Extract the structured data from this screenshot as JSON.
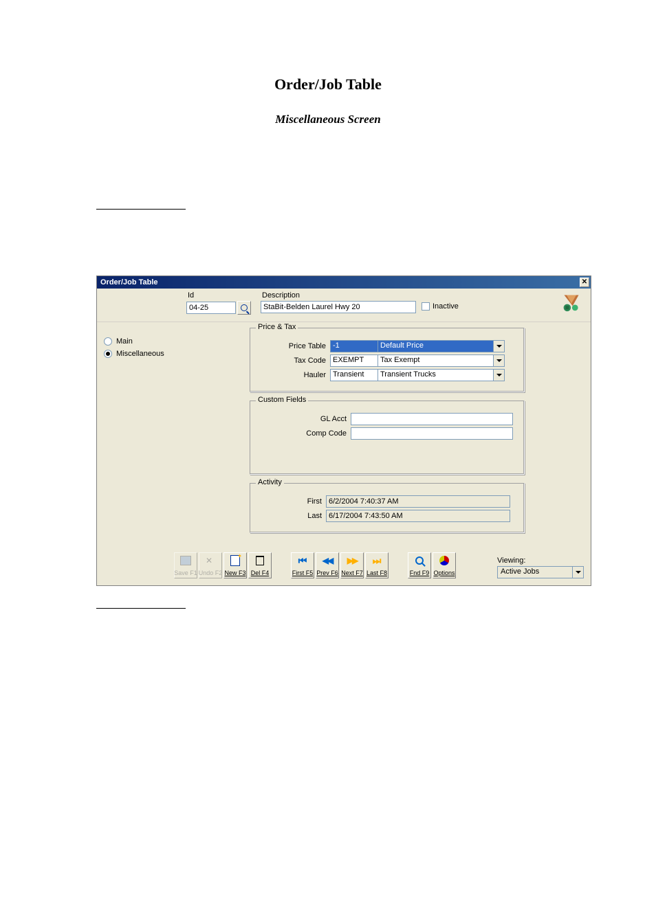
{
  "page": {
    "title": "Order/Job Table",
    "subtitle": "Miscellaneous Screen"
  },
  "window": {
    "title": "Order/Job Table",
    "close_glyph": "✕"
  },
  "header": {
    "id_label": "Id",
    "id_value": "04-25",
    "desc_label": "Description",
    "desc_value": "StaBit-Belden Laurel Hwy 20",
    "inactive_label": "Inactive",
    "inactive_checked": false
  },
  "sidebar": {
    "main_label": "Main",
    "misc_label": "Miscellaneous",
    "selected": "Miscellaneous"
  },
  "price_tax": {
    "group_label": "Price & Tax",
    "rows": {
      "price_table": {
        "label": "Price Table",
        "code": "-1",
        "desc": "Default Price",
        "highlighted": true
      },
      "tax_code": {
        "label": "Tax Code",
        "code": "EXEMPT",
        "desc": "Tax Exempt"
      },
      "hauler": {
        "label": "Hauler",
        "code": "Transient",
        "desc": "Transient Trucks"
      }
    }
  },
  "custom_fields": {
    "group_label": "Custom Fields",
    "gl_acct": {
      "label": "GL Acct",
      "value": ""
    },
    "comp_code": {
      "label": "Comp Code",
      "value": ""
    }
  },
  "activity": {
    "group_label": "Activity",
    "first": {
      "label": "First",
      "value": "6/2/2004 7:40:37 AM"
    },
    "last": {
      "label": "Last",
      "value": "6/17/2004 7:43:50 AM"
    }
  },
  "toolbar": {
    "save": "Save F1",
    "undo": "Undo F2",
    "new": "New F3",
    "del": "Del F4",
    "first": "First F5",
    "prev": "Prev F6",
    "next": "Next F7",
    "last": "Last F8",
    "find": "Fnd F9",
    "options": "Options"
  },
  "viewing": {
    "label": "Viewing:",
    "value": "Active Jobs"
  }
}
